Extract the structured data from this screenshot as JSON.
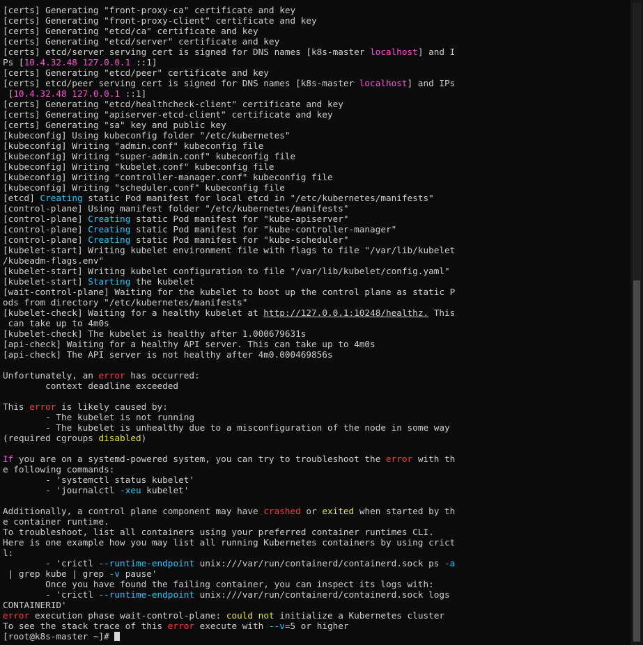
{
  "colors": {
    "background": "#0b0b0b",
    "default": "#cfcfcf",
    "magenta": "#ff4fd8",
    "cyan": "#22c8ff",
    "red": "#ff3b3b",
    "yellow": "#e6e62e"
  },
  "terminal": {
    "lines": [
      [
        {
          "t": "[certs] Generating \"front-proxy-ca\" certificate and key",
          "c": "default"
        }
      ],
      [
        {
          "t": "[certs] Generating \"front-proxy-client\" certificate and key",
          "c": "default"
        }
      ],
      [
        {
          "t": "[certs] Generating \"etcd/ca\" certificate and key",
          "c": "default"
        }
      ],
      [
        {
          "t": "[certs] Generating \"etcd/server\" certificate and key",
          "c": "default"
        }
      ],
      [
        {
          "t": "[certs] etcd/server serving cert is signed for DNS names [k8s-master ",
          "c": "default"
        },
        {
          "t": "localhost",
          "c": "magenta"
        },
        {
          "t": "] and I",
          "c": "default"
        }
      ],
      [
        {
          "t": "Ps [",
          "c": "default"
        },
        {
          "t": "10.4.32.48 127.0.0.1",
          "c": "magenta"
        },
        {
          "t": " ::1]",
          "c": "default"
        }
      ],
      [
        {
          "t": "[certs] Generating \"etcd/peer\" certificate and key",
          "c": "default"
        }
      ],
      [
        {
          "t": "[certs] etcd/peer serving cert is signed for DNS names [k8s-master ",
          "c": "default"
        },
        {
          "t": "localhost",
          "c": "magenta"
        },
        {
          "t": "] and IPs",
          "c": "default"
        }
      ],
      [
        {
          "t": " [",
          "c": "default"
        },
        {
          "t": "10.4.32.48 127.0.0.1",
          "c": "magenta"
        },
        {
          "t": " ::1]",
          "c": "default"
        }
      ],
      [
        {
          "t": "[certs] Generating \"etcd/healthcheck-client\" certificate and key",
          "c": "default"
        }
      ],
      [
        {
          "t": "[certs] Generating \"apiserver-etcd-client\" certificate and key",
          "c": "default"
        }
      ],
      [
        {
          "t": "[certs] Generating \"sa\" key and public key",
          "c": "default"
        }
      ],
      [
        {
          "t": "[kubeconfig] Using kubeconfig folder \"/etc/kubernetes\"",
          "c": "default"
        }
      ],
      [
        {
          "t": "[kubeconfig] Writing \"admin.conf\" kubeconfig file",
          "c": "default"
        }
      ],
      [
        {
          "t": "[kubeconfig] Writing \"super-admin.conf\" kubeconfig file",
          "c": "default"
        }
      ],
      [
        {
          "t": "[kubeconfig] Writing \"kubelet.conf\" kubeconfig file",
          "c": "default"
        }
      ],
      [
        {
          "t": "[kubeconfig] Writing \"controller-manager.conf\" kubeconfig file",
          "c": "default"
        }
      ],
      [
        {
          "t": "[kubeconfig] Writing \"scheduler.conf\" kubeconfig file",
          "c": "default"
        }
      ],
      [
        {
          "t": "[etcd] ",
          "c": "default"
        },
        {
          "t": "Creating",
          "c": "cyan"
        },
        {
          "t": " static Pod manifest for local etcd in \"/etc/kubernetes/manifests\"",
          "c": "default"
        }
      ],
      [
        {
          "t": "[control-plane] Using manifest folder \"/etc/kubernetes/manifests\"",
          "c": "default"
        }
      ],
      [
        {
          "t": "[control-plane] ",
          "c": "default"
        },
        {
          "t": "Creating",
          "c": "cyan"
        },
        {
          "t": " static Pod manifest for \"kube-apiserver\"",
          "c": "default"
        }
      ],
      [
        {
          "t": "[control-plane] ",
          "c": "default"
        },
        {
          "t": "Creating",
          "c": "cyan"
        },
        {
          "t": " static Pod manifest for \"kube-controller-manager\"",
          "c": "default"
        }
      ],
      [
        {
          "t": "[control-plane] ",
          "c": "default"
        },
        {
          "t": "Creating",
          "c": "cyan"
        },
        {
          "t": " static Pod manifest for \"kube-scheduler\"",
          "c": "default"
        }
      ],
      [
        {
          "t": "[kubelet-start] Writing kubelet environment file with flags to file \"/var/lib/kubelet",
          "c": "default"
        }
      ],
      [
        {
          "t": "/kubeadm-flags.env\"",
          "c": "default"
        }
      ],
      [
        {
          "t": "[kubelet-start] Writing kubelet configuration to file \"/var/lib/kubelet/config.yaml\"",
          "c": "default"
        }
      ],
      [
        {
          "t": "[kubelet-start] ",
          "c": "default"
        },
        {
          "t": "Starting",
          "c": "cyan"
        },
        {
          "t": " the kubelet",
          "c": "default"
        }
      ],
      [
        {
          "t": "[wait-control-plane] Waiting for the kubelet to boot up the control plane as static P",
          "c": "default"
        }
      ],
      [
        {
          "t": "ods from directory \"/etc/kubernetes/manifests\"",
          "c": "default"
        }
      ],
      [
        {
          "t": "[kubelet-check] Waiting for a healthy kubelet at ",
          "c": "default"
        },
        {
          "t": "http://127.0.0.1:10248/healthz.",
          "c": "link"
        },
        {
          "t": " This",
          "c": "default"
        }
      ],
      [
        {
          "t": " can take up to 4m0s",
          "c": "default"
        }
      ],
      [
        {
          "t": "[kubelet-check] The kubelet is healthy after 1.000679631s",
          "c": "default"
        }
      ],
      [
        {
          "t": "[api-check] Waiting for a healthy API server. This can take up to 4m0s",
          "c": "default"
        }
      ],
      [
        {
          "t": "[api-check] The API server is not healthy after 4m0.000469856s",
          "c": "default"
        }
      ],
      [
        {
          "t": "",
          "c": "default"
        }
      ],
      [
        {
          "t": "Unfortunately, an ",
          "c": "default"
        },
        {
          "t": "error",
          "c": "red"
        },
        {
          "t": " has occurred:",
          "c": "default"
        }
      ],
      [
        {
          "t": "        context deadline exceeded",
          "c": "default"
        }
      ],
      [
        {
          "t": "",
          "c": "default"
        }
      ],
      [
        {
          "t": "This ",
          "c": "default"
        },
        {
          "t": "error",
          "c": "red"
        },
        {
          "t": " is likely caused by:",
          "c": "default"
        }
      ],
      [
        {
          "t": "        - The kubelet is not running",
          "c": "default"
        }
      ],
      [
        {
          "t": "        - The kubelet is unhealthy due to a misconfiguration of the node in some way",
          "c": "default"
        }
      ],
      [
        {
          "t": "(required cgroups ",
          "c": "default"
        },
        {
          "t": "disabled",
          "c": "yellow"
        },
        {
          "t": ")",
          "c": "default"
        }
      ],
      [
        {
          "t": "",
          "c": "default"
        }
      ],
      [
        {
          "t": "If",
          "c": "magenta"
        },
        {
          "t": " you are on a systemd-powered system, you can try to troubleshoot the ",
          "c": "default"
        },
        {
          "t": "error",
          "c": "red"
        },
        {
          "t": " with th",
          "c": "default"
        }
      ],
      [
        {
          "t": "e following commands:",
          "c": "default"
        }
      ],
      [
        {
          "t": "        - 'systemctl status kubelet'",
          "c": "default"
        }
      ],
      [
        {
          "t": "        - 'journalctl ",
          "c": "default"
        },
        {
          "t": "-xeu",
          "c": "cyan"
        },
        {
          "t": " kubelet'",
          "c": "default"
        }
      ],
      [
        {
          "t": "",
          "c": "default"
        }
      ],
      [
        {
          "t": "Additionally, a control plane component may have ",
          "c": "default"
        },
        {
          "t": "crashed",
          "c": "red"
        },
        {
          "t": " or ",
          "c": "default"
        },
        {
          "t": "exited",
          "c": "yellow"
        },
        {
          "t": " when started by th",
          "c": "default"
        }
      ],
      [
        {
          "t": "e container runtime.",
          "c": "default"
        }
      ],
      [
        {
          "t": "To troubleshoot, list all containers using your preferred container runtimes CLI.",
          "c": "default"
        }
      ],
      [
        {
          "t": "Here is one example how you may list all running Kubernetes containers by using crict",
          "c": "default"
        }
      ],
      [
        {
          "t": "l:",
          "c": "default"
        }
      ],
      [
        {
          "t": "        - 'crictl ",
          "c": "default"
        },
        {
          "t": "--runtime-endpoint",
          "c": "cyan"
        },
        {
          "t": " unix:///var/run/containerd/containerd.sock ps ",
          "c": "default"
        },
        {
          "t": "-a",
          "c": "cyan"
        }
      ],
      [
        {
          "t": " | grep kube | grep ",
          "c": "default"
        },
        {
          "t": "-v",
          "c": "cyan"
        },
        {
          "t": " pause'",
          "c": "default"
        }
      ],
      [
        {
          "t": "        Once you have found the failing container, you can inspect its logs with:",
          "c": "default"
        }
      ],
      [
        {
          "t": "        - 'crictl ",
          "c": "default"
        },
        {
          "t": "--runtime-endpoint",
          "c": "cyan"
        },
        {
          "t": " unix:///var/run/containerd/containerd.sock logs",
          "c": "default"
        }
      ],
      [
        {
          "t": "CONTAINERID'",
          "c": "default"
        }
      ],
      [
        {
          "t": "error",
          "c": "red"
        },
        {
          "t": " execution phase wait-control-plane: ",
          "c": "default"
        },
        {
          "t": "could not",
          "c": "yellow"
        },
        {
          "t": " initialize a Kubernetes cluster",
          "c": "default"
        }
      ],
      [
        {
          "t": "To see the stack trace of this ",
          "c": "default"
        },
        {
          "t": "error",
          "c": "red"
        },
        {
          "t": " execute with ",
          "c": "default"
        },
        {
          "t": "--v",
          "c": "cyan"
        },
        {
          "t": "=5 or higher",
          "c": "default"
        }
      ]
    ],
    "prompt": "[root@k8s-master ~]# "
  }
}
